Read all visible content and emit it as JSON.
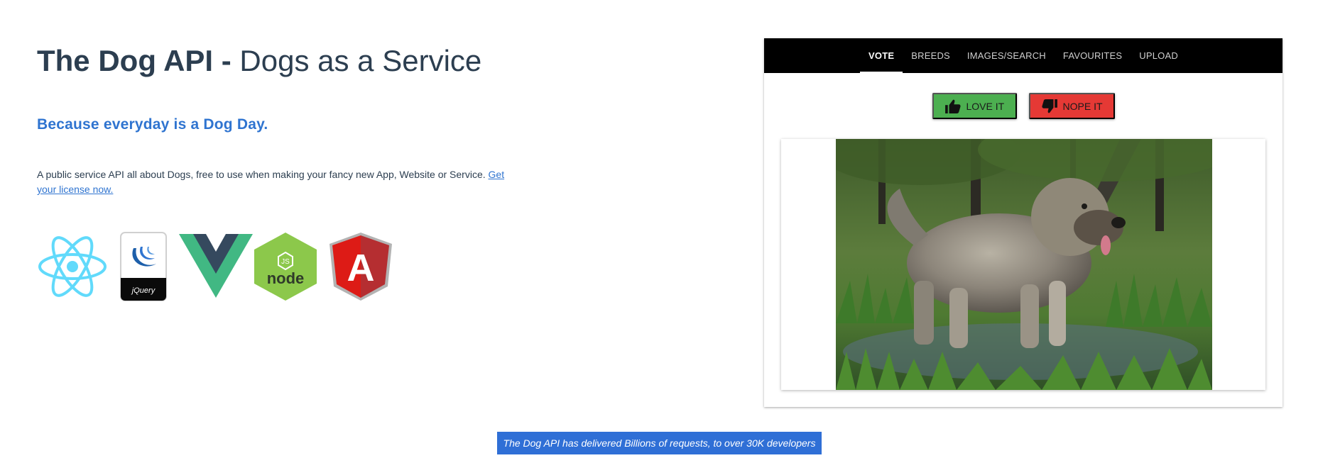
{
  "header": {
    "title_strong": "The Dog API -",
    "title_rest": " Dogs as a Service",
    "tagline": "Because everyday is a Dog Day."
  },
  "description": {
    "text": "A public service API all about Dogs, free to use when making your fancy new App, Website or Service. ",
    "link": "Get your license now."
  },
  "logos": {
    "icons": [
      "react-icon",
      "jquery-icon",
      "vue-icon",
      "nodejs-icon",
      "angular-icon"
    ],
    "jquery_label": "jQuery",
    "node_label": "node",
    "node_badge": "JS",
    "angular_letter": "A"
  },
  "nav": {
    "tabs": [
      {
        "label": "VOTE",
        "active": true
      },
      {
        "label": "BREEDS",
        "active": false
      },
      {
        "label": "IMAGES/SEARCH",
        "active": false
      },
      {
        "label": "FAVOURITES",
        "active": false
      },
      {
        "label": "UPLOAD",
        "active": false
      }
    ]
  },
  "vote": {
    "love_label": "LOVE IT",
    "nope_label": "NOPE IT",
    "love_color": "#4caf50",
    "nope_color": "#e53935"
  },
  "footer": {
    "badge": "The Dog API has delivered Billions of requests, to over 30K developers",
    "badge_color": "#2f6fd6"
  },
  "colors": {
    "accent": "#2f74d0",
    "text": "#2c3e50",
    "nav_bg": "#000000"
  }
}
